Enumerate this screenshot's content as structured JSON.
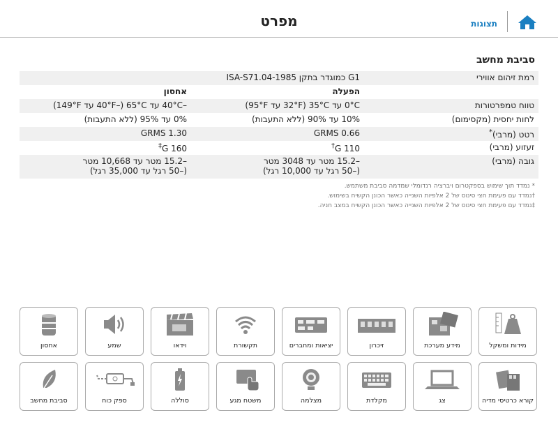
{
  "header": {
    "title": "מפרט",
    "views_label": "תצוגות",
    "home_icon": "home-icon"
  },
  "section_title": "סביבת מחשב",
  "specs": {
    "airborne": {
      "label": "רמת זיהום אווירי",
      "value": "G1 כמוגדר בתקן ISA-S71.04-1985"
    },
    "col_headers": {
      "operation": "הפעלה",
      "storage": "אחסון"
    },
    "temperature": {
      "label": "טווח טמפרטורות",
      "operation": "0°C עד 35°C (32°F עד 95°F)",
      "storage": "–40°C עד 65°C (–40°F עד 149°F)"
    },
    "humidity": {
      "label": "לחות יחסית (מקסימום)",
      "operation": "10% עד 90% (ללא התעבות)",
      "storage": "0% עד 95% (ללא התעבות)"
    },
    "vibration": {
      "label": "רטט (מרבי)",
      "label_mark": "*",
      "operation": "0.66 GRMS",
      "storage": "1.30 GRMS"
    },
    "shock": {
      "label": "זעזוע (מרבי)",
      "operation": "110 G",
      "operation_mark": "†",
      "storage": "160 G",
      "storage_mark": "‡"
    },
    "altitude": {
      "label": "גובה (מרבי)",
      "operation_line1": "–15.2 מטר עד 3048 מטר",
      "operation_line2": "(–50 רגל עד 10,000 רגל)",
      "storage_line1": "–15.2 מטר עד 10,668 מטר",
      "storage_line2": "(–50 רגל עד 35,000 רגל)"
    }
  },
  "notes": [
    "* נמדד תוך שימוש בספקטרום ויברציה רנדומלי שמדמה סביבת משתמש.",
    "†נמדד עם פעימת חצי סינוס של 2 אלפיות השנייה כאשר הכונן הקשיח בשימוש.",
    "‡נמדד עם פעימת חצי סינוס של 2 אלפיות השנייה כאשר הכונן הקשיח במצב חניה."
  ],
  "tiles_row1": [
    {
      "label": "מידות ומשקל",
      "icon": "scale-weight-icon"
    },
    {
      "label": "מידע מערכת",
      "icon": "system-board-icon"
    },
    {
      "label": "זיכרון",
      "icon": "memory-module-icon"
    },
    {
      "label": "יציאות ומחברים",
      "icon": "ports-connectors-icon"
    },
    {
      "label": "תקשורת",
      "icon": "wifi-icon"
    },
    {
      "label": "וידאו",
      "icon": "clapperboard-icon"
    },
    {
      "label": "שמע",
      "icon": "speaker-icon"
    },
    {
      "label": "אחסון",
      "icon": "storage-drive-icon"
    }
  ],
  "tiles_row2": [
    {
      "label": "קורא כרטיסי מדיה",
      "icon": "media-card-icon"
    },
    {
      "label": "צג",
      "icon": "laptop-display-icon"
    },
    {
      "label": "מקלדת",
      "icon": "keyboard-icon"
    },
    {
      "label": "מצלמה",
      "icon": "webcam-icon"
    },
    {
      "label": "משטח מגע",
      "icon": "touchpad-icon"
    },
    {
      "label": "סוללה",
      "icon": "battery-icon"
    },
    {
      "label": "ספק כוח",
      "icon": "power-adapter-icon"
    },
    {
      "label": "סביבת מחשב",
      "icon": "leaf-icon"
    }
  ],
  "colors": {
    "accent": "#1a7fc1",
    "icon_gray": "#8a8a8a",
    "row_shade": "#f0f0f0"
  }
}
